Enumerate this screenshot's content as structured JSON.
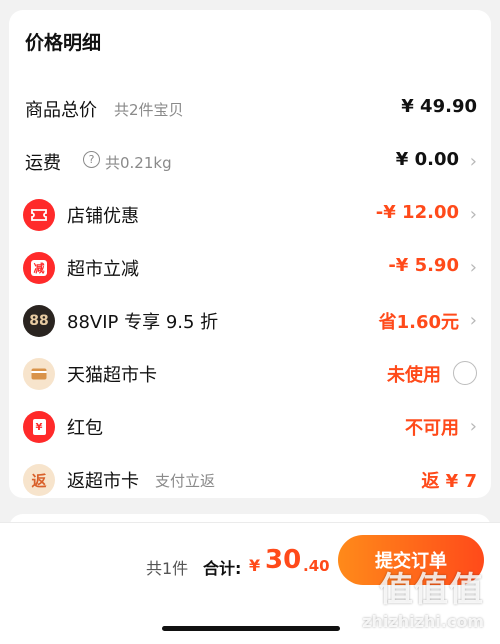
{
  "card": {
    "title": "价格明细"
  },
  "rows": [
    {
      "label": "商品总价",
      "sub": "共2件宝贝",
      "value": "¥ 49.90"
    },
    {
      "label": "运费",
      "sub": "共0.21kg",
      "value": "¥ 0.00",
      "help_icon": "?"
    },
    {
      "label": "店铺优惠",
      "value": "-¥ 12.00",
      "icon": "store-coupon-icon",
      "icon_color": "#ff2a2a"
    },
    {
      "label": "超市立减",
      "value": "-¥ 5.90",
      "icon": "supermarket-reduce-icon",
      "icon_glyph": "减",
      "icon_color": "#ff2a2a"
    },
    {
      "label": "88VIP 专享 9.5 折",
      "value": "省1.60元",
      "icon": "88vip-icon",
      "icon_glyph": "88",
      "icon_color": "#2a2420"
    },
    {
      "label": "天猫超市卡",
      "value": "未使用",
      "icon": "tmall-card-icon",
      "icon_color": "#f7e4cc"
    },
    {
      "label": "红包",
      "value": "不可用",
      "icon": "red-packet-icon",
      "icon_glyph": "¥",
      "icon_color": "#ff2a2a"
    },
    {
      "label": "返超市卡",
      "sub": "支付立返",
      "value": "返 ¥ 7",
      "icon": "rebate-card-icon",
      "icon_glyph": "返",
      "icon_color": "#f7e4cc"
    }
  ],
  "footer": {
    "qty": "共1件",
    "total_label": "合计:",
    "currency": "¥",
    "total_int": "30",
    "total_dec": ".40",
    "submit_label": "提交订单"
  },
  "watermark": {
    "glyphs": "值值值",
    "url": "zhizhizhi.com"
  },
  "colors": {
    "accent": "#ff4a1a",
    "submit_gradient_start": "#ff8a1a"
  }
}
